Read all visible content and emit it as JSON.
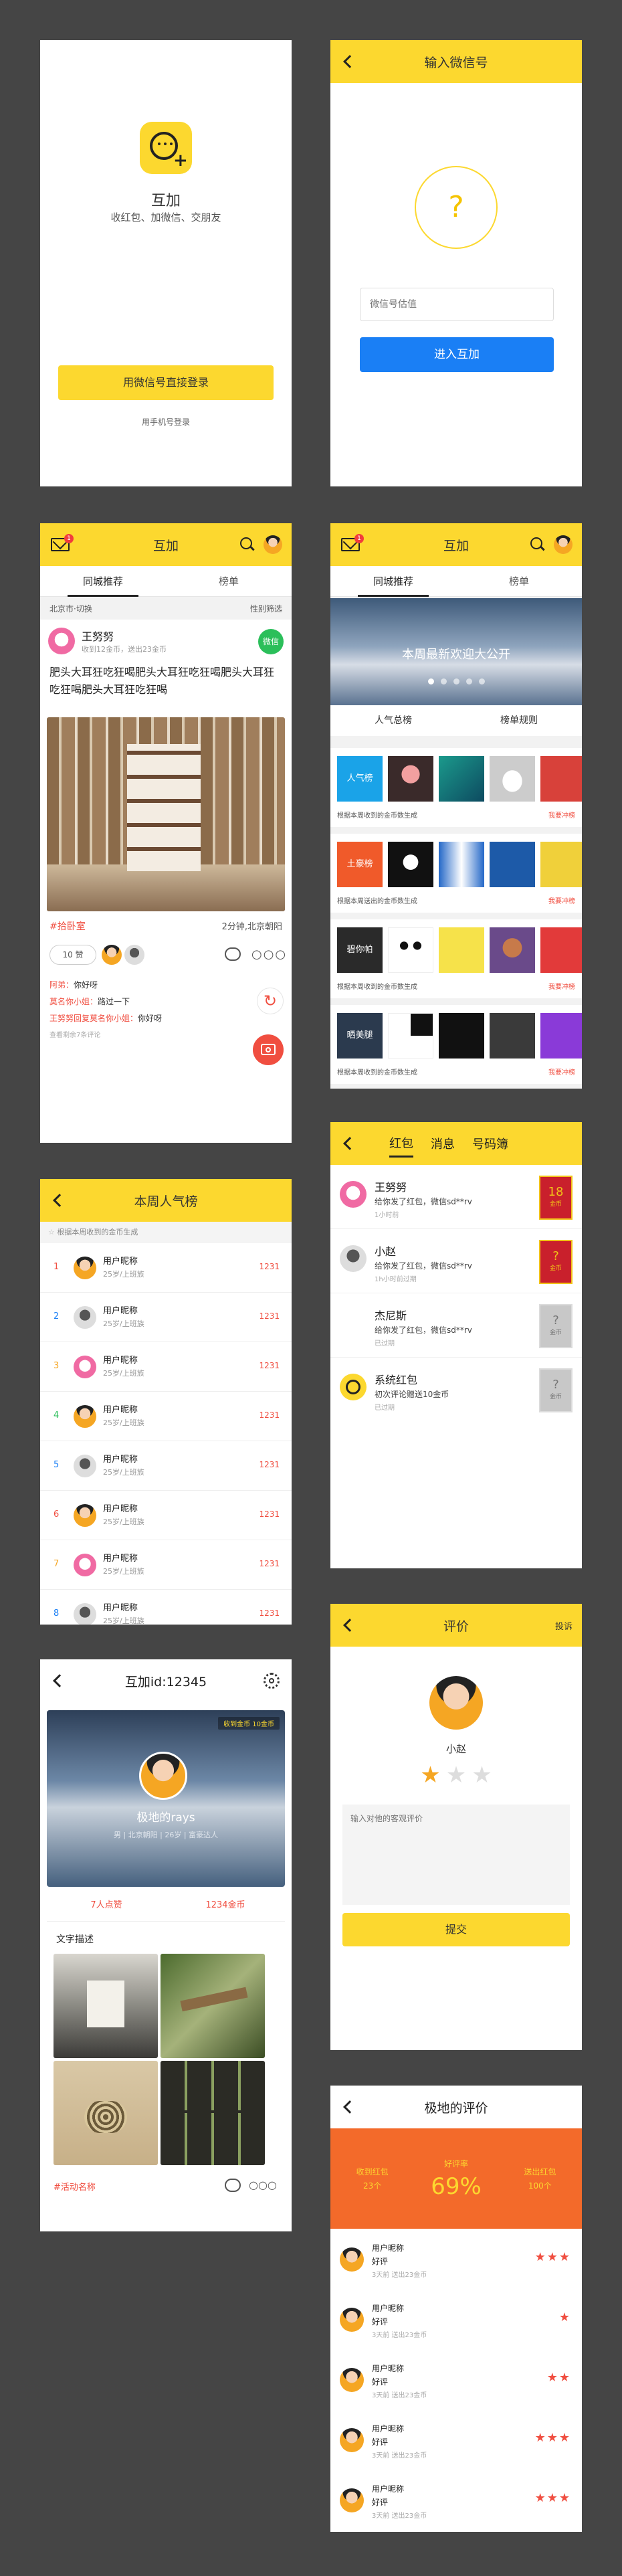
{
  "login": {
    "app_name": "互加",
    "slogan": "收红包、加微信、交朋友",
    "wechat_login_label": "用微信号直接登录",
    "phone_login_label": "用手机号登录"
  },
  "input_wechat": {
    "title": "输入微信号",
    "placeholder": "微信号估值",
    "enter_label": "进入互加",
    "question_mark": "?"
  },
  "feed": {
    "title": "互加",
    "mail_badge": "1",
    "tabs": [
      "同城推荐",
      "榜单"
    ],
    "location": "北京市·切换",
    "filter": "性别筛选",
    "post": {
      "username": "王努努",
      "meta": "收到12金币，送出23金币",
      "wechat_badge": "微信",
      "text": "肥头大耳狂吃狂喝肥头大耳狂吃狂喝肥头大耳狂吃狂喝肥头大耳狂吃狂喝",
      "tag": "#拾卧室",
      "time_loc": "2分钟,北京朝阳",
      "likes": "10 赞",
      "comments": [
        {
          "user": "阿弟：",
          "text": "你好呀"
        },
        {
          "user": "莫名你小姐：",
          "text": "路过一下"
        },
        {
          "user": "王努努回复莫名你小姐：",
          "text": "你好呀"
        }
      ],
      "more_comments": "查看剩余7条评论"
    }
  },
  "ranking": {
    "title": "互加",
    "mail_badge": "1",
    "tabs": [
      "同城推荐",
      "榜单"
    ],
    "banner_text": "本周最新欢迎大公开",
    "sub_tabs": [
      "人气总榜",
      "榜单规则"
    ],
    "rows": [
      {
        "first_label": "人气榜",
        "caption": "根据本周收到的金币数生成",
        "more": "我要冲榜"
      },
      {
        "first_label": "土豪榜",
        "caption": "根据本周送出的金币数生成",
        "more": "我要冲榜"
      },
      {
        "first_label": "碧你帕",
        "caption": "根据本周收到的金币数生成",
        "more": "我要冲榜"
      },
      {
        "first_label": "晒美腿",
        "caption": "根据本周收到的金币数生成",
        "more": "我要冲榜"
      }
    ]
  },
  "popularity": {
    "title": "本周人气榜",
    "subtitle": "根据本周收到的金币生成",
    "items": [
      {
        "rank": "1",
        "name": "用户昵称",
        "info": "25岁/上班族",
        "score": "1231"
      },
      {
        "rank": "2",
        "name": "用户昵称",
        "info": "25岁/上班族",
        "score": "1231"
      },
      {
        "rank": "3",
        "name": "用户昵称",
        "info": "25岁/上班族",
        "score": "1231"
      },
      {
        "rank": "4",
        "name": "用户昵称",
        "info": "25岁/上班族",
        "score": "1231"
      },
      {
        "rank": "5",
        "name": "用户昵称",
        "info": "25岁/上班族",
        "score": "1231"
      },
      {
        "rank": "6",
        "name": "用户昵称",
        "info": "25岁/上班族",
        "score": "1231"
      },
      {
        "rank": "7",
        "name": "用户昵称",
        "info": "25岁/上班族",
        "score": "1231"
      },
      {
        "rank": "8",
        "name": "用户昵称",
        "info": "25岁/上班族",
        "score": "1231"
      }
    ]
  },
  "messages": {
    "tabs": [
      "红包",
      "消息",
      "号码簿"
    ],
    "items": [
      {
        "name": "王努努",
        "text": "给你发了红包，微信sd**rv",
        "time": "1小时前",
        "packet_amount": "18",
        "packet_unit": "金币",
        "packet_state": "open"
      },
      {
        "name": "小赵",
        "text": "给你发了红包，微信sd**rv",
        "time": "1h小时前过期",
        "packet_amount": "?",
        "packet_unit": "金币",
        "packet_state": "open"
      },
      {
        "name": "杰尼斯",
        "text": "给你发了红包，微信sd**rv",
        "time": "已过期",
        "packet_amount": "?",
        "packet_unit": "金币",
        "packet_state": "expired"
      },
      {
        "name": "系统红包",
        "text": "初次评论赠送10金币",
        "time": "已过期",
        "packet_amount": "?",
        "packet_unit": "金币",
        "packet_state": "expired"
      }
    ]
  },
  "profile": {
    "title": "互加id:12345",
    "received_badge": "收到金币 10金币",
    "name": "极地的rays",
    "info": "男 | 北京朝阳 | 26岁 | 富豪达人",
    "followers": "7人点赞",
    "coins": "1234金币",
    "desc_title": "文字描述",
    "tag": "#活动名称"
  },
  "review": {
    "title": "评价",
    "report": "投诉",
    "name": "小赵",
    "rating": 1,
    "placeholder": "输入对他的客观评价",
    "submit_label": "提交"
  },
  "reviews_list": {
    "title": "极地的评价",
    "stats": [
      {
        "label": "收到红包",
        "value": "23个"
      },
      {
        "label": "好评率",
        "value": "69%"
      },
      {
        "label": "送出红包",
        "value": "100个"
      }
    ],
    "items": [
      {
        "name": "用户昵称",
        "verdict": "好评",
        "meta": "3天前 送出23金币",
        "stars": 3
      },
      {
        "name": "用户昵称",
        "verdict": "好评",
        "meta": "3天前 送出23金币",
        "stars": 1
      },
      {
        "name": "用户昵称",
        "verdict": "好评",
        "meta": "3天前 送出23金币",
        "stars": 2
      },
      {
        "name": "用户昵称",
        "verdict": "好评",
        "meta": "3天前 送出23金币",
        "stars": 3
      },
      {
        "name": "用户昵称",
        "verdict": "好评",
        "meta": "3天前 送出23金币",
        "stars": 3
      }
    ]
  }
}
